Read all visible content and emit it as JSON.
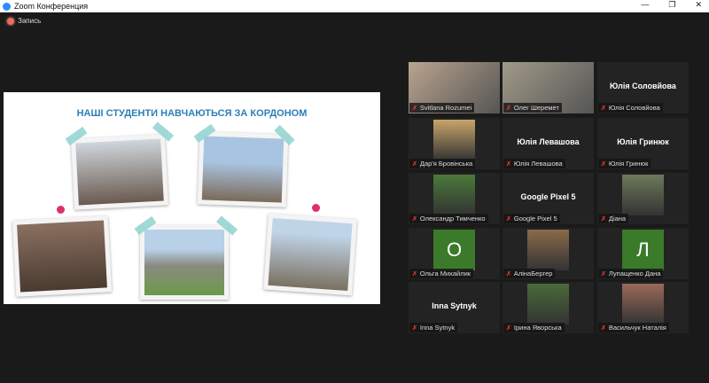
{
  "window": {
    "title": "Zoom Конференция",
    "controls": [
      "—",
      "❐",
      "✕"
    ]
  },
  "recording": {
    "label": "Запись"
  },
  "slide": {
    "title": "НАШІ СТУДЕНТИ НАВЧАЮТЬСЯ ЗА КОРДОНОМ"
  },
  "participants": [
    {
      "name": "Svitlana Rozumei",
      "type": "video",
      "color": "#b9a48e"
    },
    {
      "name": "Олег Шеремет",
      "type": "video",
      "color": "#a09a88",
      "active": true
    },
    {
      "name": "Юлія Соловйова",
      "type": "name"
    },
    {
      "name": "Дар'я Бровінська",
      "type": "photo",
      "color": "#c9a56a"
    },
    {
      "name": "Юлія Левашова",
      "type": "name"
    },
    {
      "name": "Юлія  Гринюк",
      "type": "name"
    },
    {
      "name": "Олександр Тимченко",
      "type": "photo",
      "color": "#4b7a3a"
    },
    {
      "name": "Google Pixel 5",
      "type": "name"
    },
    {
      "name": "Діана",
      "type": "photo",
      "color": "#6d7a5a"
    },
    {
      "name": "Ольга Михайлик",
      "type": "avatar",
      "initial": "О"
    },
    {
      "name": "АлінаБергер",
      "type": "photo",
      "color": "#8a6a4a"
    },
    {
      "name": "Лупащенко Дана",
      "type": "avatar",
      "initial": "Л"
    },
    {
      "name": "Inna Sytnyk",
      "type": "name"
    },
    {
      "name": "Ірина Яворська",
      "type": "photo",
      "color": "#4a6a3a"
    },
    {
      "name": "Васильчук Наталія",
      "type": "photo",
      "color": "#9a6a5a"
    }
  ]
}
